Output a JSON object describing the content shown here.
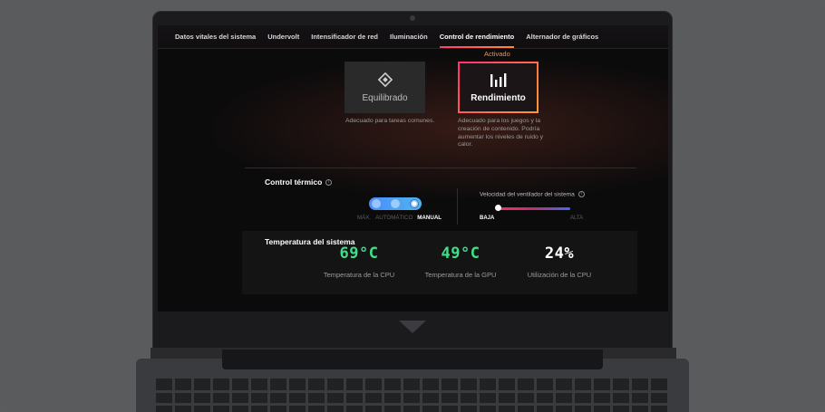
{
  "tabs": [
    {
      "label": "Datos vitales del sistema",
      "active": false
    },
    {
      "label": "Undervolt",
      "active": false
    },
    {
      "label": "Intensificador de red",
      "active": false
    },
    {
      "label": "Iluminación",
      "active": false
    },
    {
      "label": "Control de rendimiento",
      "active": true
    },
    {
      "label": "Alternador de gráficos",
      "active": false
    }
  ],
  "performance_modes": {
    "active_badge": "Activado",
    "balanced": {
      "label": "Equilibrado",
      "icon": "diamond-icon",
      "description": "Adecuado para tareas comunes."
    },
    "performance": {
      "label": "Rendimiento",
      "icon": "bar-chart-icon",
      "description": "Adecuado para los juegos y la creación de contenido. Podría aumentar los niveles de ruido y calor.",
      "selected": true
    }
  },
  "thermal_control": {
    "title": "Control térmico",
    "options": [
      "MÁX.",
      "AUTOMÁTICO",
      "MANUAL"
    ],
    "selected": "MANUAL",
    "fan_speed": {
      "title": "Velocidad del ventilador del sistema",
      "low_label": "BAJA",
      "high_label": "ALTA",
      "level": 0
    }
  },
  "system_temperature": {
    "title": "Temperatura del sistema",
    "metrics": [
      {
        "value": "69°C",
        "label": "Temperatura de la CPU",
        "color": "#3ee08a"
      },
      {
        "value": "49°C",
        "label": "Temperatura de la GPU",
        "color": "#3ee08a"
      },
      {
        "value": "24%",
        "label": "Utilización de la CPU",
        "color": "#ffffff"
      }
    ]
  },
  "colors": {
    "accent_gradient_start": "#ff2f74",
    "accent_gradient_end": "#ff9a2f",
    "slider_blue": "#4a8cff"
  }
}
